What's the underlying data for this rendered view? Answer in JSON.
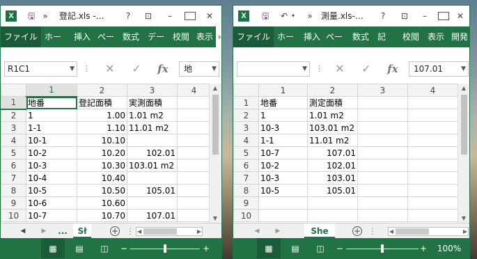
{
  "w1": {
    "title": "登記.xls -…",
    "tabs": [
      "ファイル",
      "ホー",
      "挿入",
      "ペー",
      "数式",
      "デー",
      "校閲",
      "表示"
    ],
    "name_box": "R1C1",
    "formula_value": "地",
    "col_headers": [
      "1",
      "2",
      "3",
      "4"
    ],
    "rows": [
      {
        "n": "1",
        "c": [
          "地番",
          "登記面積",
          "実測面積",
          ""
        ]
      },
      {
        "n": "2",
        "c": [
          "1",
          "1.00",
          "1.01 m2",
          ""
        ]
      },
      {
        "n": "3",
        "c": [
          "1-1",
          "1.10",
          "11.01 m2",
          ""
        ]
      },
      {
        "n": "4",
        "c": [
          "10-1",
          "10.10",
          "",
          ""
        ]
      },
      {
        "n": "5",
        "c": [
          "10-2",
          "10.20",
          "102.01",
          ""
        ]
      },
      {
        "n": "6",
        "c": [
          "10-3",
          "10.30",
          "103.01 m2",
          ""
        ]
      },
      {
        "n": "7",
        "c": [
          "10-4",
          "10.40",
          "",
          ""
        ]
      },
      {
        "n": "8",
        "c": [
          "10-5",
          "10.50",
          "105.01",
          ""
        ]
      },
      {
        "n": "9",
        "c": [
          "10-6",
          "10.60",
          "",
          ""
        ]
      },
      {
        "n": "10",
        "c": [
          "10-7",
          "10.70",
          "107.01",
          ""
        ]
      }
    ],
    "sheet_tab": "Sł",
    "sheet_ellipsis": "..."
  },
  "w2": {
    "title": "測量.xls-…",
    "tabs": [
      "ファイル",
      "ホー",
      "挿入",
      "ペー",
      "数式",
      "記",
      "校閲",
      "表示",
      "開発"
    ],
    "name_box": "",
    "formula_value": "107.01",
    "col_headers": [
      "1",
      "2",
      "3",
      "4"
    ],
    "rows": [
      {
        "n": "1",
        "c": [
          "地番",
          "測定面積",
          "",
          ""
        ]
      },
      {
        "n": "2",
        "c": [
          "1",
          "1.01 m2",
          "",
          ""
        ]
      },
      {
        "n": "3",
        "c": [
          "10-3",
          "103.01 m2",
          "",
          ""
        ]
      },
      {
        "n": "4",
        "c": [
          "1-1",
          "11.01 m2",
          "",
          ""
        ]
      },
      {
        "n": "5",
        "c": [
          "10-7",
          "107.01",
          "",
          ""
        ]
      },
      {
        "n": "6",
        "c": [
          "10-2",
          "102.01",
          "",
          ""
        ]
      },
      {
        "n": "7",
        "c": [
          "10-3",
          "103.01",
          "",
          ""
        ]
      },
      {
        "n": "8",
        "c": [
          "10-5",
          "105.01",
          "",
          ""
        ]
      },
      {
        "n": "9",
        "c": [
          "",
          "",
          "",
          ""
        ]
      },
      {
        "n": "10",
        "c": [
          "",
          "",
          "",
          ""
        ]
      }
    ],
    "sheet_tab": "She",
    "zoom": "100%"
  },
  "glyphs": {
    "excel": "X",
    "save": "🖫",
    "more": "»",
    "help": "?",
    "restore": "⊡",
    "minimize": "–",
    "close": "✕",
    "undo": "↶",
    "cancel": "✕",
    "enter": "✓",
    "fx": "fx",
    "plus": "+",
    "minus": "−"
  }
}
